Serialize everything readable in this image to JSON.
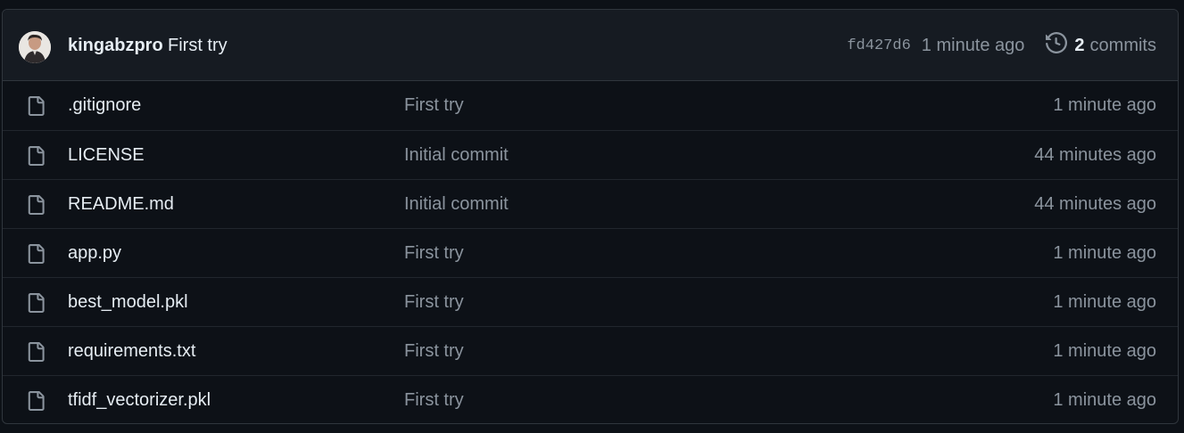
{
  "latest_commit": {
    "author": "kingabzpro",
    "message": "First try",
    "sha": "fd427d6",
    "age": "1 minute ago",
    "commit_count": "2",
    "commit_label": "commits"
  },
  "files": [
    {
      "name": ".gitignore",
      "message": "First try",
      "time": "1 minute ago",
      "icon": "file-icon"
    },
    {
      "name": "LICENSE",
      "message": "Initial commit",
      "time": "44 minutes ago",
      "icon": "file-icon"
    },
    {
      "name": "README.md",
      "message": "Initial commit",
      "time": "44 minutes ago",
      "icon": "file-icon"
    },
    {
      "name": "app.py",
      "message": "First try",
      "time": "1 minute ago",
      "icon": "file-icon"
    },
    {
      "name": "best_model.pkl",
      "message": "First try",
      "time": "1 minute ago",
      "icon": "file-icon"
    },
    {
      "name": "requirements.txt",
      "message": "First try",
      "time": "1 minute ago",
      "icon": "file-icon"
    },
    {
      "name": "tfidf_vectorizer.pkl",
      "message": "First try",
      "time": "1 minute ago",
      "icon": "file-icon"
    }
  ],
  "colors": {
    "background": "#0d1117",
    "header_background": "#161b22",
    "border": "#30363d",
    "text_primary": "#e6edf3",
    "text_muted": "#8b949e"
  }
}
